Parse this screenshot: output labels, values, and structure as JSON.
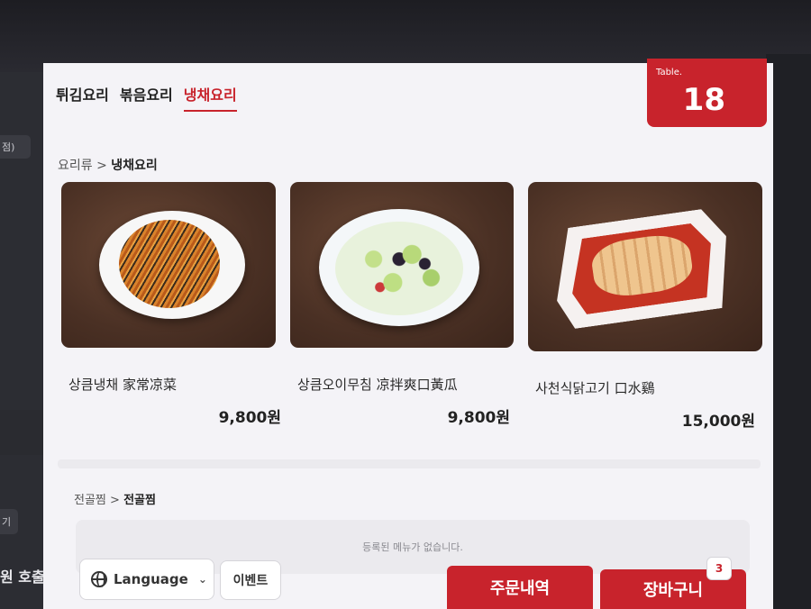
{
  "tabs": [
    {
      "label": "튀김요리",
      "active": false
    },
    {
      "label": "볶음요리",
      "active": false
    },
    {
      "label": "냉채요리",
      "active": true
    }
  ],
  "table": {
    "label": "Table.",
    "number": "18"
  },
  "breadcrumb": {
    "parent": "요리류",
    "separator": ">",
    "current": "냉채요리"
  },
  "menu_items": [
    {
      "name": "상큼냉채 家常凉菜",
      "price": "9,800원",
      "image_icon": "cold-noodle-dish-icon"
    },
    {
      "name": "상큼오이무침 凉拌爽口黃瓜",
      "price": "9,800원",
      "image_icon": "cucumber-salad-icon"
    },
    {
      "name": "사천식닭고기 口水鷄",
      "price": "15,000원",
      "image_icon": "sichuan-chicken-icon"
    }
  ],
  "section2": {
    "parent": "전골찜",
    "separator": ">",
    "current": "전골찜",
    "empty_text": "등록된 메뉴가 없습니다."
  },
  "bottom_bar": {
    "language_label": "Language",
    "event_label": "이벤트",
    "order_history_label": "주문내역",
    "cart_label": "장바구니",
    "cart_count": "3"
  },
  "side": {
    "stub_top": "점)",
    "stub_bottom": "기",
    "call_label": "원 호출"
  },
  "colors": {
    "accent": "#c8232c",
    "background": "#f4f3f7"
  }
}
